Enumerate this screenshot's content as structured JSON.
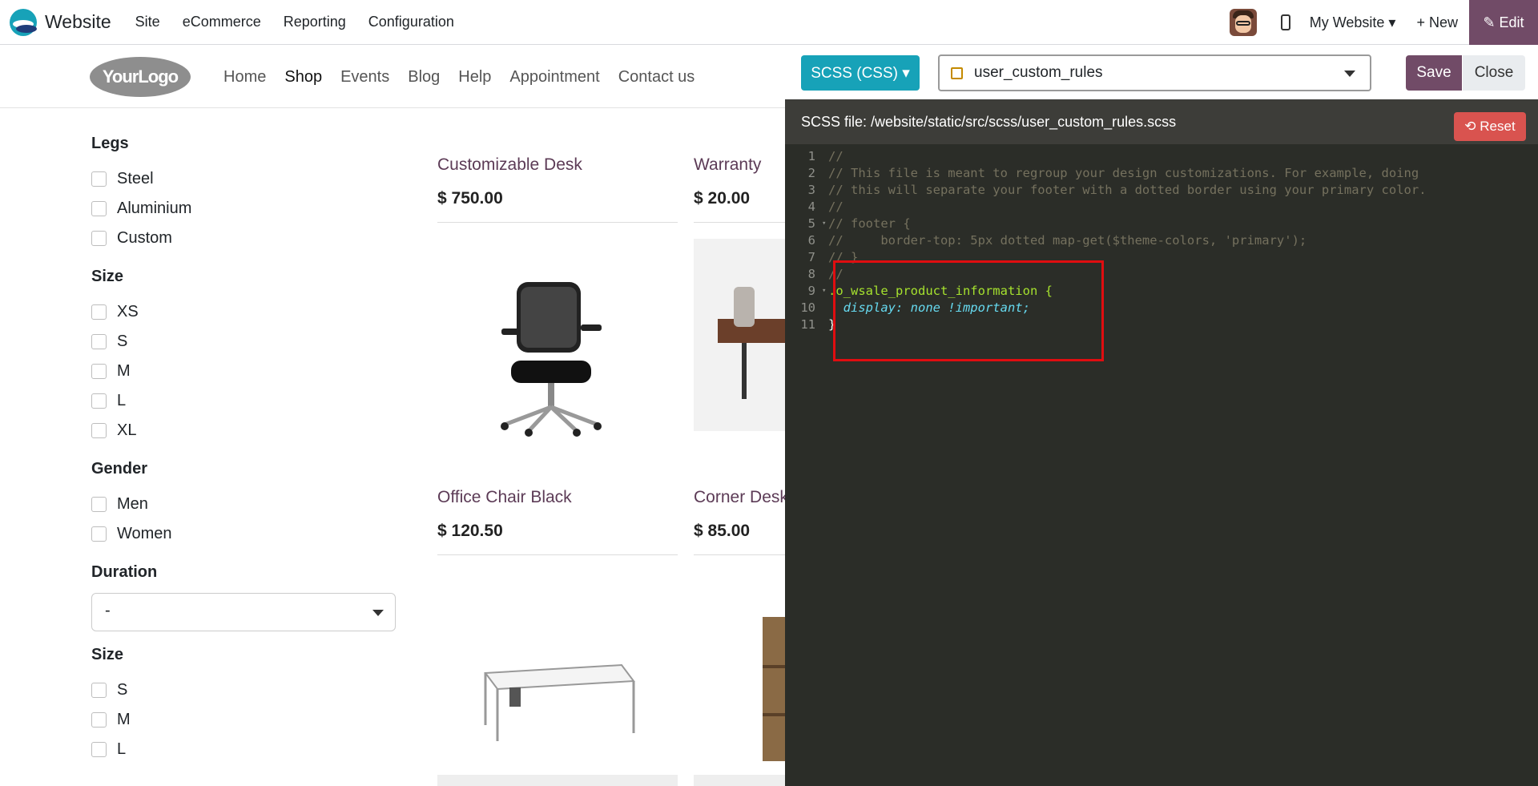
{
  "topbar": {
    "app_name": "Website",
    "menu": [
      "Site",
      "eCommerce",
      "Reporting",
      "Configuration"
    ],
    "website_selector": "My Website ▾",
    "new_label": "+ New",
    "edit_label": "✎ Edit"
  },
  "site": {
    "logo_text": "YourLogo",
    "nav": [
      "Home",
      "Shop",
      "Events",
      "Blog",
      "Help",
      "Appointment",
      "Contact us"
    ]
  },
  "filters": {
    "legs": {
      "title": "Legs",
      "options": [
        "Steel",
        "Aluminium",
        "Custom"
      ]
    },
    "size": {
      "title": "Size",
      "options": [
        "XS",
        "S",
        "M",
        "L",
        "XL"
      ]
    },
    "gender": {
      "title": "Gender",
      "options": [
        "Men",
        "Women"
      ]
    },
    "duration": {
      "title": "Duration",
      "value": "-"
    },
    "size2": {
      "title": "Size",
      "options": [
        "S",
        "M",
        "L"
      ]
    }
  },
  "products": [
    {
      "name": "Customizable Desk",
      "price": "$ 750.00"
    },
    {
      "name": "Warranty",
      "price": "$ 20.00"
    },
    {
      "name": "Office Chair Black",
      "price": "$ 120.50"
    },
    {
      "name": "Corner Desk Right Sit",
      "price": "$ 85.00"
    }
  ],
  "editor": {
    "language": "SCSS (CSS) ▾",
    "file": "user_custom_rules",
    "save": "Save",
    "close": "Close",
    "path": "SCSS file: /website/static/src/scss/user_custom_rules.scss",
    "reset": "⟲ Reset",
    "lines": [
      "//",
      "// This file is meant to regroup your design customizations. For example, doing",
      "// this will separate your footer with a dotted border using your primary color.",
      "//",
      "// footer {",
      "//     border-top: 5px dotted map-get($theme-colors, 'primary');",
      "// }",
      "//",
      ".o_wsale_product_information {",
      "  display: none !important;",
      "}"
    ]
  },
  "colors": {
    "brand": "#714b67",
    "accent": "#17a2b8",
    "danger": "#d9534f",
    "highlight": "#e00d10"
  }
}
